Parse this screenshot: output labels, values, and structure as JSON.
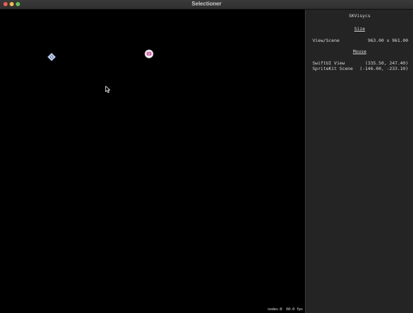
{
  "window": {
    "title": "Selectioner"
  },
  "scene": {
    "stats": "nodes:8  60.0 fps",
    "sprites": [
      {
        "name": "diamond-sprite",
        "color": "#5b7fb8"
      },
      {
        "name": "round-sprite",
        "color": "#c0398a"
      }
    ]
  },
  "panel": {
    "title": "SKVisycs",
    "size": {
      "heading": "Size",
      "rows": [
        {
          "label": "View/Scene",
          "value": "963.00 x 961.00"
        }
      ]
    },
    "mouse": {
      "heading": "Mouse",
      "rows": [
        {
          "label": "SwiftUI View",
          "value": "(335.50, 247.40)"
        },
        {
          "label": "SpriteKit Scene",
          "value": "(-146.00, -233.10)"
        }
      ]
    }
  }
}
